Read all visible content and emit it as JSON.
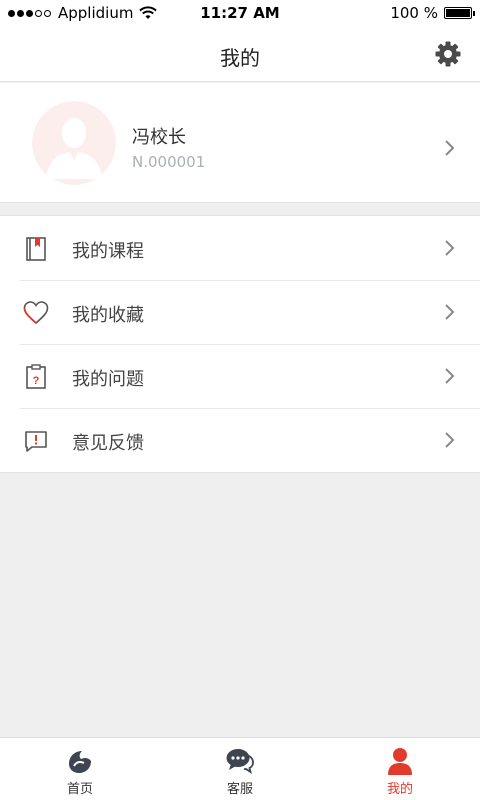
{
  "status_bar": {
    "carrier": "Applidium",
    "time": "11:27 AM",
    "battery": "100 %",
    "battery_level": 1.0
  },
  "nav": {
    "title": "我的",
    "settings_icon": "gear-icon"
  },
  "profile": {
    "name": "冯校长",
    "id": "N.000001",
    "avatar_icon": "user-silhouette-icon"
  },
  "menu": {
    "items": [
      {
        "label": "我的课程",
        "icon": "book-bookmark-icon"
      },
      {
        "label": "我的收藏",
        "icon": "heart-icon"
      },
      {
        "label": "我的问题",
        "icon": "clipboard-question-icon"
      },
      {
        "label": "意见反馈",
        "icon": "feedback-bubble-icon"
      }
    ]
  },
  "tab_bar": {
    "tabs": [
      {
        "label": "首页",
        "icon": "home-logo-icon",
        "active": false
      },
      {
        "label": "客服",
        "icon": "chat-bubbles-icon",
        "active": false
      },
      {
        "label": "我的",
        "icon": "person-icon",
        "active": true
      }
    ]
  },
  "colors": {
    "accent": "#e23b2e",
    "background": "#efefef",
    "secondary_text": "#aab0b6"
  }
}
